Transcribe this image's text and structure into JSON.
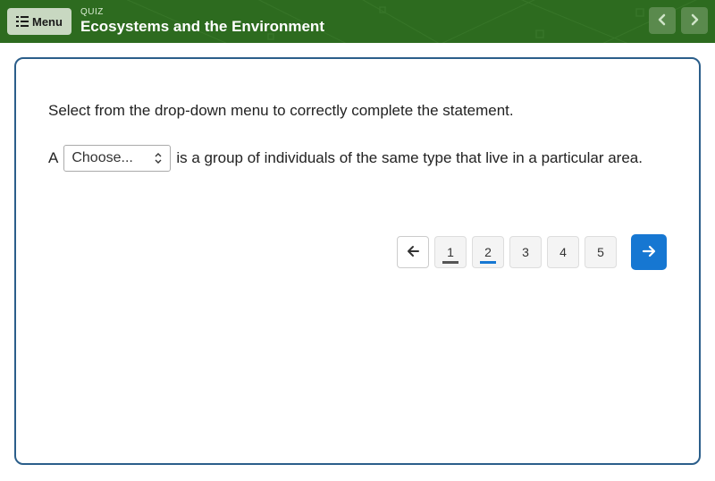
{
  "header": {
    "menu_label": "Menu",
    "quiz_label": "QUIZ",
    "title": "Ecosystems and the Environment"
  },
  "question": {
    "instruction": "Select from the drop-down menu to correctly complete the statement.",
    "before": "A",
    "dropdown_value": "Choose...",
    "after": "is a group of individuals of the same type that live in a particular area."
  },
  "pager": {
    "items": [
      {
        "label": "1",
        "state": "done"
      },
      {
        "label": "2",
        "state": "current"
      },
      {
        "label": "3",
        "state": ""
      },
      {
        "label": "4",
        "state": ""
      },
      {
        "label": "5",
        "state": ""
      }
    ]
  }
}
